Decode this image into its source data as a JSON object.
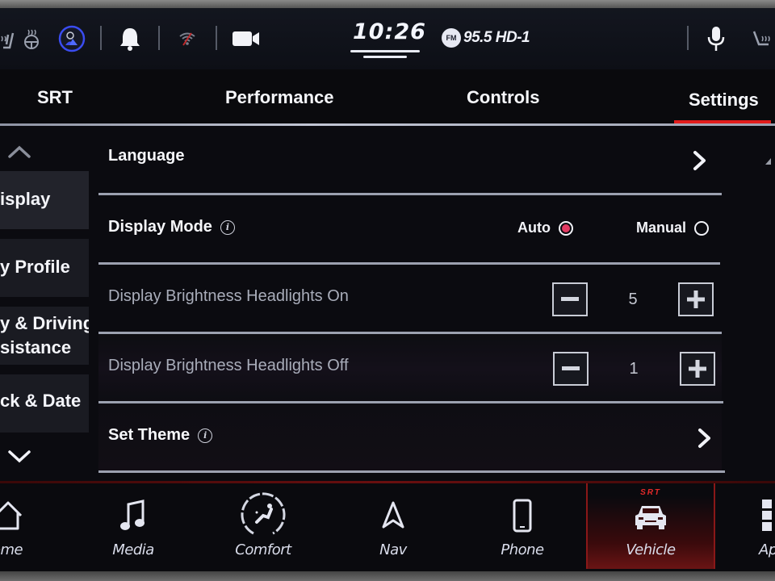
{
  "status_bar": {
    "icons_left": [
      "heated-seat-icon",
      "heated-steering-wheel-icon",
      "driver-profile-icon",
      "bell-icon",
      "wifi-icon",
      "camera-icon"
    ],
    "clock": "10:26",
    "radio_band": "FM",
    "radio_station": "95.5 HD-1",
    "icons_right": [
      "microphone-icon",
      "heated-seat-passenger-icon"
    ],
    "driver_profile_ring_color": "#3a4cf0"
  },
  "tabs": {
    "items": [
      {
        "label": "SRT"
      },
      {
        "label": "Performance"
      },
      {
        "label": "Controls"
      },
      {
        "label": "Settings"
      }
    ],
    "active": "Settings",
    "active_color": "#e21c1c"
  },
  "sidebar": {
    "items": [
      {
        "label": "Display",
        "visible_text": "isplay"
      },
      {
        "label": "Radio Profile",
        "visible_text": "y Profile"
      },
      {
        "label": "Safety & Driving Assistance",
        "visible_text_line1": "y & Driving",
        "visible_text_line2": "sistance"
      },
      {
        "label": "Clock & Date",
        "visible_text": "ck & Date"
      }
    ],
    "selected": "Display"
  },
  "settings": {
    "language": {
      "label": "Language"
    },
    "display_mode": {
      "label": "Display Mode",
      "options": [
        {
          "label": "Auto",
          "selected": true
        },
        {
          "label": "Manual",
          "selected": false
        }
      ],
      "selected_color": "#e23a62"
    },
    "brightness_on": {
      "label": "Display Brightness Headlights On",
      "value": "5"
    },
    "brightness_off": {
      "label": "Display Brightness Headlights Off",
      "value": "1"
    },
    "set_theme": {
      "label": "Set Theme"
    }
  },
  "bottom_nav": {
    "items": [
      {
        "label": "Home",
        "visible_text": "ome",
        "icon": "home-icon"
      },
      {
        "label": "Media",
        "icon": "music-note-icon"
      },
      {
        "label": "Comfort",
        "icon": "comfort-seat-icon"
      },
      {
        "label": "Nav",
        "icon": "navigation-arrow-icon"
      },
      {
        "label": "Phone",
        "icon": "phone-icon"
      },
      {
        "label": "Vehicle",
        "icon": "vehicle-icon",
        "badge": "SRT"
      },
      {
        "label": "Apps",
        "visible_text": "Ap",
        "icon": "apps-grid-icon"
      }
    ],
    "active": "Vehicle",
    "badge_color": "#e52a2a"
  }
}
